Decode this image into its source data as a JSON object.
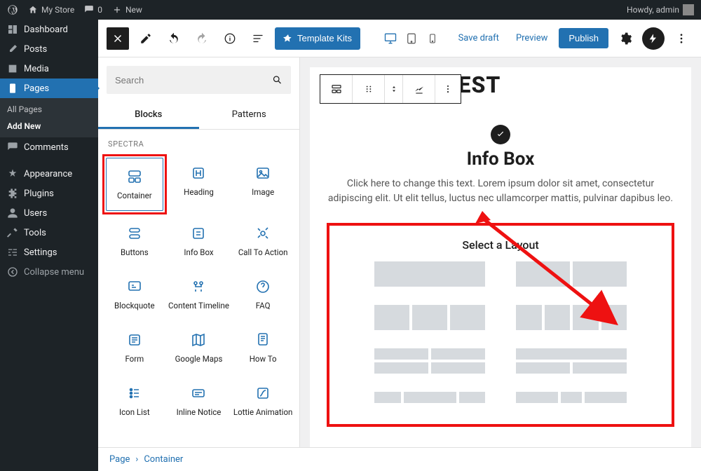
{
  "adminbar": {
    "site": "My Store",
    "comments": "0",
    "new": "New",
    "howdy": "Howdy, admin"
  },
  "sidebar": {
    "items": [
      {
        "label": "Dashboard"
      },
      {
        "label": "Posts"
      },
      {
        "label": "Media"
      },
      {
        "label": "Pages"
      },
      {
        "label": "Comments"
      },
      {
        "label": "Appearance"
      },
      {
        "label": "Plugins"
      },
      {
        "label": "Users"
      },
      {
        "label": "Tools"
      },
      {
        "label": "Settings"
      }
    ],
    "sub": {
      "all": "All Pages",
      "add": "Add New"
    },
    "collapse": "Collapse menu"
  },
  "topbar": {
    "template_kits": "Template Kits",
    "save_draft": "Save draft",
    "preview": "Preview",
    "publish": "Publish"
  },
  "inserter": {
    "search_placeholder": "Search",
    "tab_blocks": "Blocks",
    "tab_patterns": "Patterns",
    "category": "Spectra",
    "blocks": [
      "Container",
      "Heading",
      "Image",
      "Buttons",
      "Info Box",
      "Call To Action",
      "Blockquote",
      "Content Timeline",
      "FAQ",
      "Form",
      "Google Maps",
      "How To",
      "Icon List",
      "Inline Notice",
      "Lottie Animation"
    ]
  },
  "canvas": {
    "title_ghost": "SPECTRA TEST",
    "info_title": "Info Box",
    "info_desc": "Click here to change this text. Lorem ipsum dolor sit amet, consectetur adipiscing elit. Ut elit tellus, luctus nec ullamcorper mattis, pulvinar dapibus leo.",
    "layout_title": "Select a Layout"
  },
  "breadcrumb": {
    "a": "Page",
    "sep": "›",
    "b": "Container"
  }
}
